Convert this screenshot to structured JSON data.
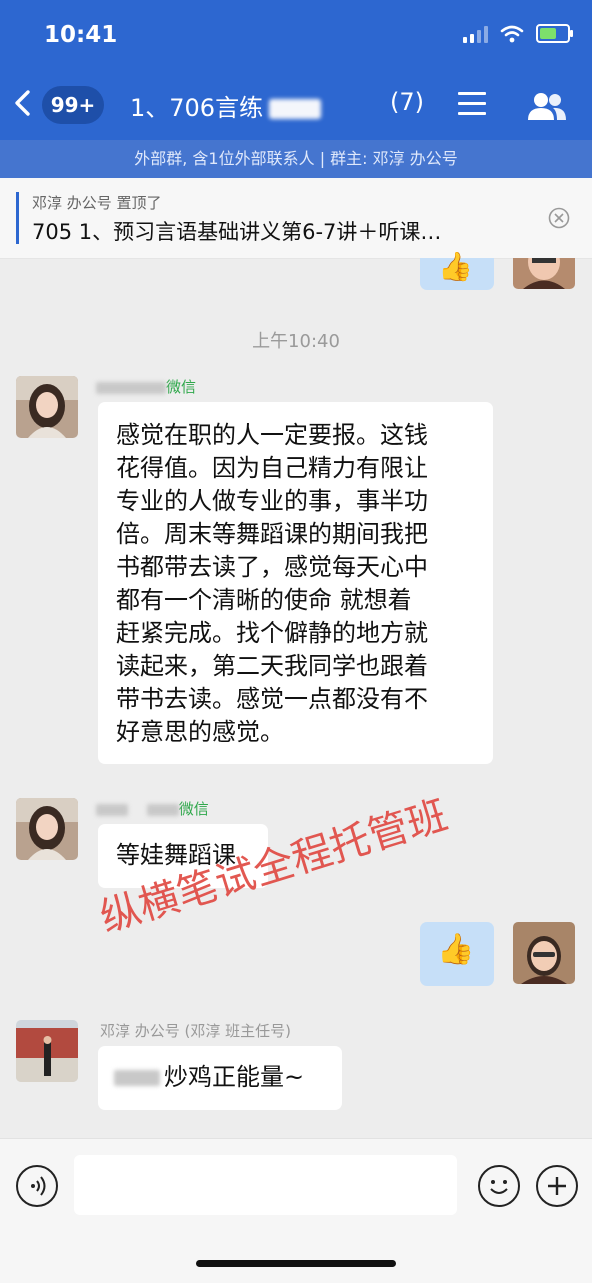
{
  "status_bar": {
    "time": "10:41"
  },
  "nav": {
    "back_icon": "chevron-left-icon",
    "unread_badge": "99+",
    "title": "1、706言练",
    "member_count": "(7)",
    "menu_icon": "hamburger-icon",
    "members_icon": "group-members-icon"
  },
  "subtitle": "外部群, 含1位外部联系人 | 群主: 邓淳 办公号",
  "pinned": {
    "who": "邓淳 办公号 置顶了",
    "text": "705 1、预习言语基础讲义第6-7讲＋听课…"
  },
  "time_separator": "上午10:40",
  "messages": [
    {
      "tag": "微信",
      "text": "感觉在职的人一定要报。这钱花得值。因为自己精力有限让专业的人做专业的事，事半功倍。周末等舞蹈课的期间我把书都带去读了，感觉每天心中都有一个清晰的使命 就想着赶紧完成。找个僻静的地方就读起来，第二天我同学也跟着带书去读。感觉一点都没有不好意思的感觉。",
      "lines": [
        "感觉在职的人一定要报。这钱",
        "花得值。因为自己精力有限让",
        "专业的人做专业的事，事半功",
        "倍。周末等舞蹈课的期间我把",
        "书都带去读了，感觉每天心中",
        "都有一个清晰的使命 就想着",
        "赶紧完成。找个僻静的地方就",
        "读起来，第二天我同学也跟着",
        "带书去读。感觉一点都没有不",
        "好意思的感觉。"
      ]
    },
    {
      "tag": "微信",
      "text": "等娃舞蹈课"
    },
    {
      "sender": "me",
      "emoji": "👍"
    },
    {
      "name": "邓淳 办公号 (邓淳 班主任号)",
      "text": "炒鸡正能量~"
    }
  ],
  "watermark": "纵横笔试全程托管班",
  "input_bar": {
    "voice_icon": "voice-icon",
    "emoji_icon": "emoji-smile-icon",
    "plus_icon": "plus-icon"
  },
  "colors": {
    "header": "#2d67d0",
    "subbar": "#4575cf",
    "my_bubble": "#c6dff8",
    "wechat_tag": "#2fa84b"
  }
}
